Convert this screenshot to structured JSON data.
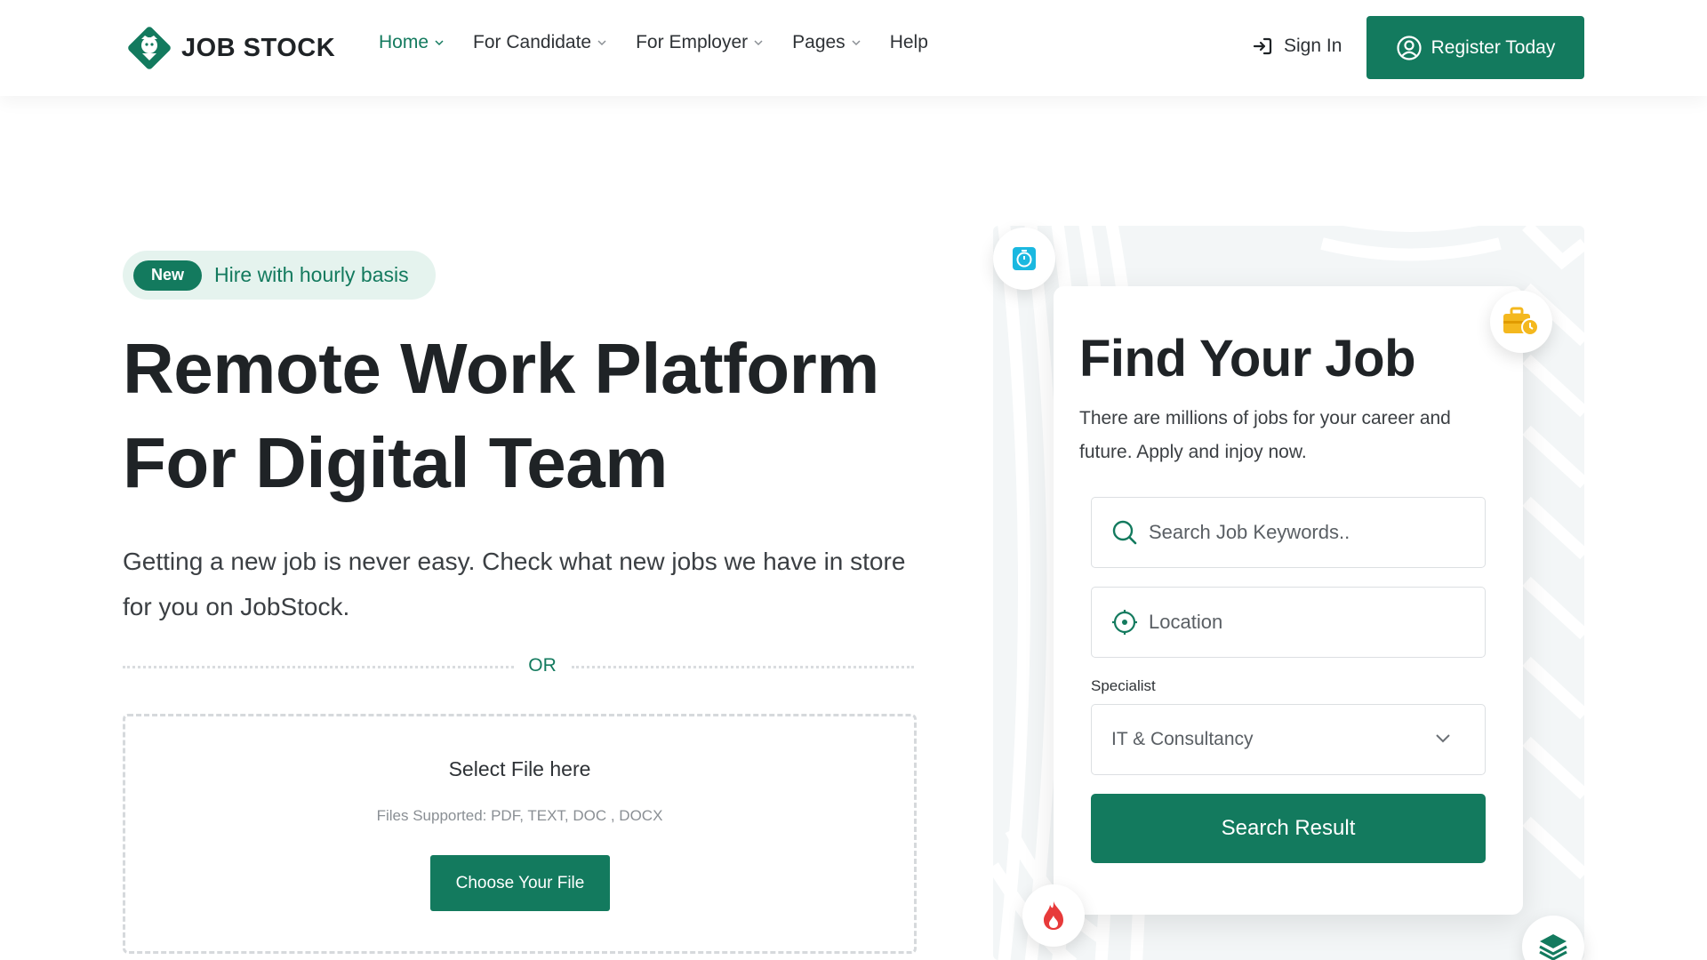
{
  "brand": {
    "name": "JOB STOCK",
    "accent": "#137a5e"
  },
  "nav": {
    "items": [
      {
        "label": "Home",
        "has_dropdown": true,
        "active": true
      },
      {
        "label": "For Candidate",
        "has_dropdown": true,
        "active": false
      },
      {
        "label": "For Employer",
        "has_dropdown": true,
        "active": false
      },
      {
        "label": "Pages",
        "has_dropdown": true,
        "active": false
      },
      {
        "label": "Help",
        "has_dropdown": false,
        "active": false
      }
    ],
    "sign_in": "Sign In",
    "register": "Register Today"
  },
  "hero": {
    "badge_pill": "New",
    "badge_text": "Hire with hourly basis",
    "title_line1": "Remote Work Platform",
    "title_line2": "For Digital Team",
    "description": "Getting a new job is never easy. Check what new jobs we have in store for you on JobStock.",
    "or_text": "OR",
    "upload": {
      "title": "Select File here",
      "supported": "Files Supported: PDF, TEXT, DOC , DOCX",
      "button": "Choose Your File"
    }
  },
  "finder": {
    "title": "Find Your Job",
    "description": "There are millions of jobs for your career and future. Apply and injoy now.",
    "keyword_placeholder": "Search Job Keywords..",
    "location_placeholder": "Location",
    "specialist_label": "Specialist",
    "specialist_value": "IT & Consultancy",
    "search_button": "Search Result"
  },
  "icons": {
    "logo": "shield-mascot-icon",
    "float_top_left": "stopwatch-icon",
    "float_top_right": "briefcase-clock-icon",
    "float_bottom_left": "fire-icon",
    "float_bottom_right": "layers-icon"
  }
}
